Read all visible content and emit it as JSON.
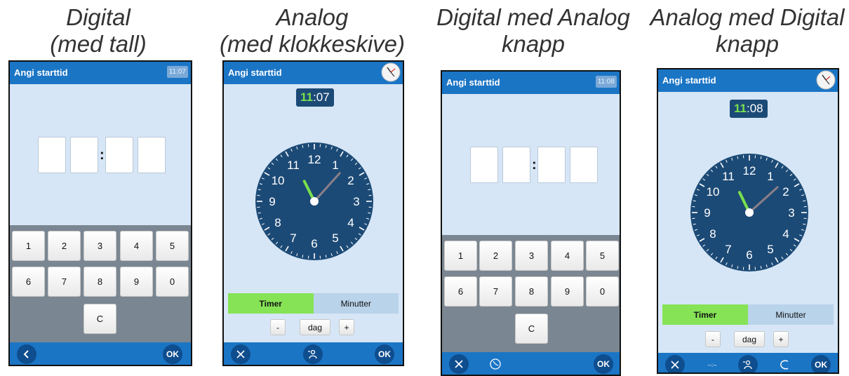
{
  "captions": [
    [
      "Digital",
      "(med tall)"
    ],
    [
      "Analog",
      "(med klokkeskive)"
    ],
    [
      "Digital med Analog",
      "knapp"
    ],
    [
      "Analog med Digital",
      "knapp"
    ]
  ],
  "screens": [
    {
      "title": "Angi starttid",
      "header_time": "11:07"
    },
    {
      "title": "Angi starttid",
      "hour": "11",
      "sep": ":",
      "minute": "07",
      "tab_hours": "Timer",
      "tab_minutes": "Minutter",
      "minus": "-",
      "day": "dag",
      "plus": "+",
      "ok": "OK"
    },
    {
      "title": "Angi starttid",
      "header_time": "11:08",
      "ok": "OK"
    },
    {
      "title": "Angi starttid",
      "hour": "11",
      "sep": ":",
      "minute": "08",
      "tab_hours": "Timer",
      "tab_minutes": "Minutter",
      "minus": "-",
      "day": "dag",
      "plus": "+",
      "ok": "OK",
      "digital_icon": "--:--"
    }
  ],
  "keypad": [
    "1",
    "2",
    "3",
    "4",
    "5",
    "6",
    "7",
    "8",
    "9",
    "0",
    "C"
  ],
  "ok_label": "OK",
  "dial_numbers": [
    "12",
    "1",
    "2",
    "3",
    "4",
    "5",
    "6",
    "7",
    "8",
    "9",
    "10",
    "11"
  ],
  "colors": {
    "header": "#1b75c5",
    "body": "#d6e6f6",
    "dial": "#1c4a76",
    "accent_green": "#79e04c",
    "tab_active": "#86e356"
  },
  "icons": [
    "back-icon",
    "close-icon",
    "voice-icon",
    "analog-clock-icon",
    "digital-clock-icon",
    "clear-icon"
  ]
}
